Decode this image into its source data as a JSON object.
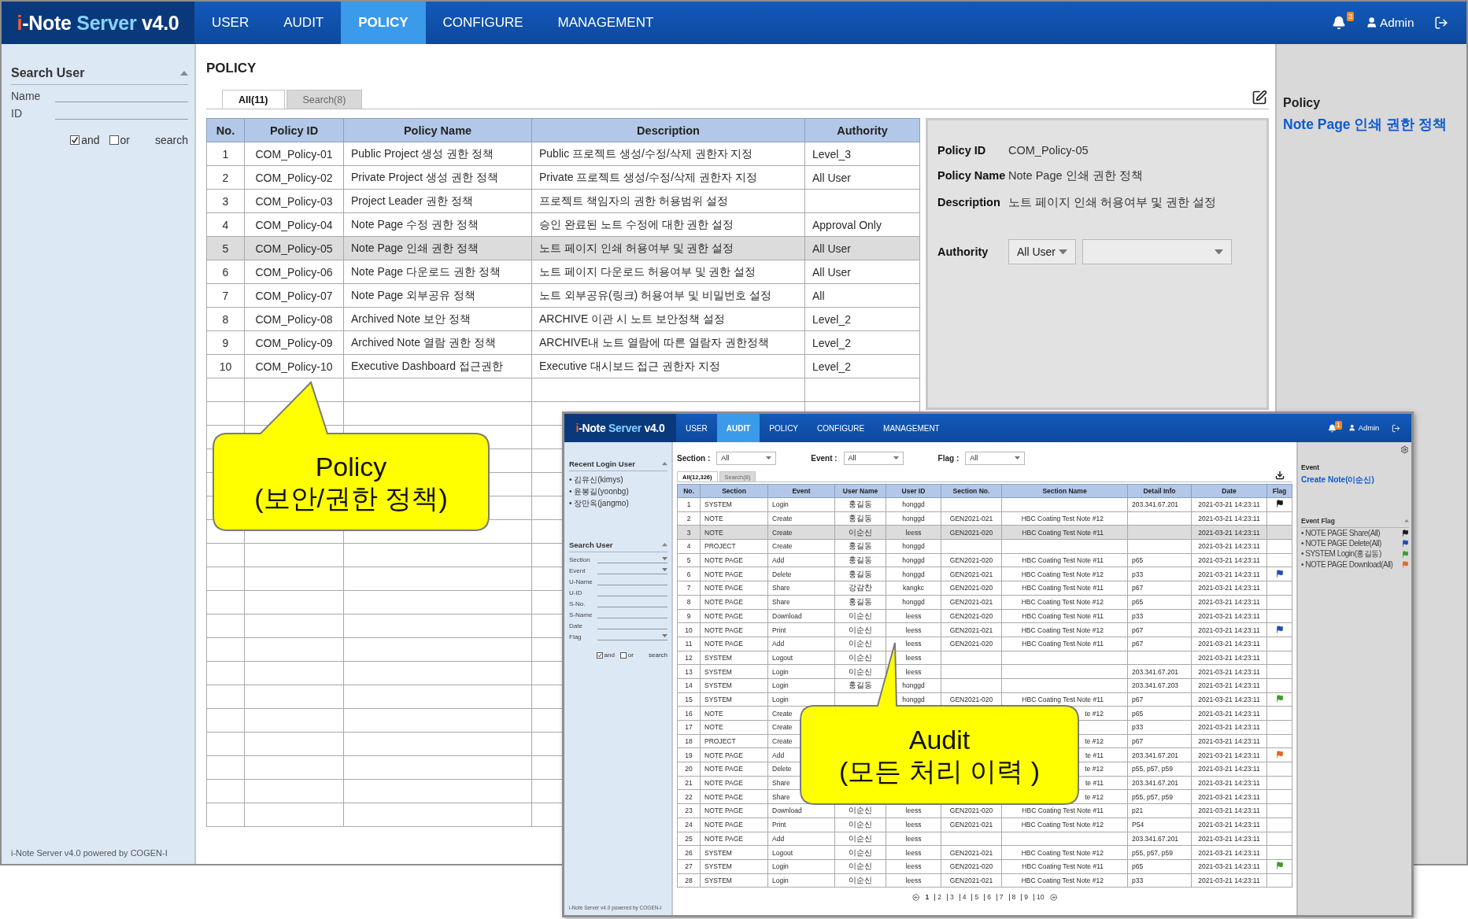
{
  "main": {
    "logo": {
      "mark": "i",
      "name": "-Note",
      "product": "Server",
      "version": "v4.0"
    },
    "nav": [
      {
        "label": "USER",
        "selected": false
      },
      {
        "label": "AUDIT",
        "selected": false
      },
      {
        "label": "POLICY",
        "selected": true
      },
      {
        "label": "CONFIGURE",
        "selected": false
      },
      {
        "label": "MANAGEMENT",
        "selected": false
      }
    ],
    "notifications": "3",
    "user": "Admin",
    "sidebar": {
      "title": "Search User",
      "fields": [
        {
          "label": "Name"
        },
        {
          "label": "ID"
        }
      ],
      "match_options": [
        {
          "label": "and",
          "checked": true
        },
        {
          "label": "or",
          "checked": false
        }
      ],
      "search": "search",
      "footer": "i-Note Server v4.0 powered by COGEN-I"
    },
    "page_title": "POLICY",
    "tabs": [
      {
        "label": "All(11)",
        "selected": true
      },
      {
        "label": "Search(8)",
        "selected": false
      }
    ],
    "table": {
      "columns": [
        "No.",
        "Policy ID",
        "Policy Name",
        "Description",
        "Authority"
      ],
      "rows": [
        {
          "no": "1",
          "policy_id": "COM_Policy-01",
          "policy_name": "Public Project 생성 권한 정책",
          "description": "Public 프로젝트 생성/수정/삭제 권한자 지정",
          "authority": "Level_3",
          "selected": false
        },
        {
          "no": "2",
          "policy_id": "COM_Policy-02",
          "policy_name": "Private Project 생성 권한 정책",
          "description": "Private 프로젝트 생성/수정/삭제 권한자 지정",
          "authority": "All User",
          "selected": false
        },
        {
          "no": "3",
          "policy_id": "COM_Policy-03",
          "policy_name": "Project Leader 권한 정책",
          "description": "프로젝트 책임자의 권한 허용범위 설정",
          "selected": false
        },
        {
          "no": "4",
          "policy_id": "COM_Policy-04",
          "policy_name": "Note Page 수정 권한 정책",
          "description": "승인 완료된 노트 수정에 대한 권한 설정",
          "authority": "Approval Only",
          "selected": false
        },
        {
          "no": "5",
          "policy_id": "COM_Policy-05",
          "policy_name": "Note Page 인쇄 권한 정책",
          "description": "노트 페이지 인쇄 허용여부 및 권한 설정",
          "authority": "All User",
          "selected": true
        },
        {
          "no": "6",
          "policy_id": "COM_Policy-06",
          "policy_name": "Note Page 다운로드 권한 정책",
          "description": "노트 페이지 다운로드 허용여부 및 권한 설정",
          "authority": "All User",
          "selected": false
        },
        {
          "no": "7",
          "policy_id": "COM_Policy-07",
          "policy_name": "Note Page 외부공유 정책",
          "description": "노트 외부공유(링크) 허용여부 및 비밀번호 설정",
          "authority": "All",
          "selected": false
        },
        {
          "no": "8",
          "policy_id": "COM_Policy-08",
          "policy_name": "Archived Note 보안 정책",
          "description": "ARCHIVE 이관 시 노트 보안정책 설정",
          "authority": "Level_2",
          "selected": false
        },
        {
          "no": "9",
          "policy_id": "COM_Policy-09",
          "policy_name": "Archived Note 열람 권한 정책",
          "description": "ARCHIVE내 노트 열람에 따른 열람자 권한정책",
          "authority": "Level_2",
          "selected": false
        },
        {
          "no": "10",
          "policy_id": "COM_Policy-10",
          "policy_name": "Executive Dashboard 접근권한",
          "description": "Executive 대시보드 접근 권한자 지정",
          "authority": "Level_2",
          "selected": false
        }
      ]
    },
    "detail": {
      "fields": [
        {
          "label": "Policy ID",
          "value": "COM_Policy-05"
        },
        {
          "label": "Policy Name",
          "value": "Note Page 인쇄 권한 정책"
        },
        {
          "label": "Description",
          "value": "노트 페이지 인쇄 허용여부 및 권한 설정"
        }
      ],
      "authority": {
        "label": "Authority",
        "value": "All User"
      }
    },
    "side_panel": {
      "label": "Policy",
      "value": "Note Page 인쇄 권한 정책"
    }
  },
  "audit_window": {
    "logo": {
      "mark": "i",
      "name": "-Note",
      "product": "Server",
      "version": "v4.0"
    },
    "nav": [
      {
        "label": "USER",
        "selected": false
      },
      {
        "label": "AUDIT",
        "selected": true
      },
      {
        "label": "POLICY",
        "selected": false
      },
      {
        "label": "CONFIGURE",
        "selected": false
      },
      {
        "label": "MANAGEMENT",
        "selected": false
      }
    ],
    "notifications": "1",
    "user": "Admin",
    "recent_login": {
      "title": "Recent Login User",
      "users": [
        "• 김유신(kimys)",
        "• 윤봉길(yoonbg)",
        "• 장만옥(jangmo)"
      ]
    },
    "search_user": {
      "title": "Search User",
      "fields": [
        {
          "label": "Section",
          "kind": "select"
        },
        {
          "label": "Event",
          "kind": "select"
        },
        {
          "label": "U-Name",
          "kind": "text"
        },
        {
          "label": "U-ID",
          "kind": "text"
        },
        {
          "label": "S-No.",
          "kind": "text"
        },
        {
          "label": "S-Name",
          "kind": "text"
        },
        {
          "label": "Date",
          "kind": "text"
        },
        {
          "label": "Flag",
          "kind": "select"
        }
      ],
      "match_options": [
        {
          "label": "and",
          "checked": true
        },
        {
          "label": "or",
          "checked": false
        }
      ],
      "search": "search"
    },
    "footer": "i-Note Server v4.0 powered by COGEN-I",
    "filters": [
      {
        "label": "Section :",
        "value": "All"
      },
      {
        "label": "Event :",
        "value": "All"
      },
      {
        "label": "Flag :",
        "value": "All"
      }
    ],
    "tabs": [
      {
        "label": "All(12,326)",
        "selected": true
      },
      {
        "label": "Search(8)",
        "selected": false
      }
    ],
    "table": {
      "columns": [
        "No.",
        "Section",
        "Event",
        "User Name",
        "User ID",
        "Section No.",
        "Section Name",
        "Detail Info",
        "Date",
        "Flag"
      ],
      "rows": [
        {
          "no": "1",
          "section": "SYSTEM",
          "event": "Login",
          "user_name": "홍길동",
          "user_id": "honggd",
          "detail_info": "203.341.67.201",
          "date": "2021-03-21 14:23:11",
          "color": "#1a1a1a",
          "selected": false
        },
        {
          "no": "2",
          "section": "NOTE",
          "event": "Create",
          "user_name": "홍길동",
          "user_id": "honggd",
          "section_no": "GEN2021-021",
          "section_name": "HBC Coating Test Note #12",
          "date": "2021-03-21 14:23:11",
          "selected": false
        },
        {
          "no": "3",
          "section": "NOTE",
          "event": "Create",
          "user_name": "이순신",
          "user_id": "leess",
          "section_no": "GEN2021-020",
          "section_name": "HBC Coating Test Note #11",
          "date": "2021-03-21 14:23:11",
          "selected": true
        },
        {
          "no": "4",
          "section": "PROJECT",
          "event": "Create",
          "user_name": "홍길동",
          "user_id": "honggd",
          "date": "2021-03-21 14:23:11",
          "selected": false
        },
        {
          "no": "5",
          "section": "NOTE PAGE",
          "event": "Add",
          "user_name": "홍길동",
          "user_id": "honggd",
          "section_no": "GEN2021-020",
          "section_name": "HBC Coating Test Note #11",
          "detail_info": "p65",
          "date": "2021-03-21 14:23:11",
          "selected": false
        },
        {
          "no": "6",
          "section": "NOTE PAGE",
          "event": "Delete",
          "user_name": "홍길동",
          "user_id": "honggd",
          "section_no": "GEN2021-021",
          "section_name": "HBC Coating Test Note #12",
          "detail_info": "p33",
          "date": "2021-03-21 14:23:11",
          "color": "#1f4fb5",
          "selected": false
        },
        {
          "no": "7",
          "section": "NOTE PAGE",
          "event": "Share",
          "user_name": "강감찬",
          "user_id": "kangkc",
          "section_no": "GEN2021-020",
          "section_name": "HBC Coating Test Note #11",
          "detail_info": "p67",
          "date": "2021-03-21 14:23:11",
          "selected": false
        },
        {
          "no": "8",
          "section": "NOTE PAGE",
          "event": "Share",
          "user_name": "홍길동",
          "user_id": "honggd",
          "section_no": "GEN2021-021",
          "section_name": "HBC Coating Test Note #12",
          "detail_info": "p65",
          "date": "2021-03-21 14:23:11",
          "selected": false
        },
        {
          "no": "9",
          "section": "NOTE PAGE",
          "event": "Download",
          "user_name": "이순신",
          "user_id": "leess",
          "section_no": "GEN2021-020",
          "section_name": "HBC Coating Test Note #11",
          "detail_info": "p33",
          "date": "2021-03-21 14:23:11",
          "selected": false
        },
        {
          "no": "10",
          "section": "NOTE PAGE",
          "event": "Print",
          "user_name": "이순신",
          "user_id": "leess",
          "section_no": "GEN2021-021",
          "section_name": "HBC Coating Test Note #12",
          "detail_info": "p67",
          "date": "2021-03-21 14:23:11",
          "color": "#1f4fb5",
          "selected": false
        },
        {
          "no": "11",
          "section": "NOTE PAGE",
          "event": "Add",
          "user_name": "이순신",
          "user_id": "leess",
          "section_no": "GEN2021-020",
          "section_name": "HBC Coating Test Note #11",
          "detail_info": "p67",
          "date": "2021-03-21 14:23:11",
          "selected": false
        },
        {
          "no": "12",
          "section": "SYSTEM",
          "event": "Logout",
          "user_name": "이순신",
          "user_id": "leess",
          "date": "2021-03-21 14:23:11",
          "selected": false
        },
        {
          "no": "13",
          "section": "SYSTEM",
          "event": "Login",
          "user_name": "이순신",
          "user_id": "leess",
          "detail_info": "203.341.67.201",
          "date": "2021-03-21 14:23:11",
          "selected": false
        },
        {
          "no": "14",
          "section": "SYSTEM",
          "event": "Login",
          "user_name": "홍길동",
          "user_id": "honggd",
          "detail_info": "203.341.67.203",
          "date": "2021-03-21 14:23:11",
          "selected": false
        },
        {
          "no": "15",
          "section": "SYSTEM",
          "event": "Login",
          "user_id": "honggd",
          "section_no": "GEN2021-020",
          "section_name": "HBC Coating Test Note #11",
          "detail_info": "p67",
          "date": "2021-03-21 14:23:11",
          "color": "#3f9a2c",
          "selected": false
        },
        {
          "no": "16",
          "section": "NOTE",
          "event": "Create",
          "section_name": "te #12",
          "detail_info": "p65",
          "date": "2021-03-21 14:23:11",
          "selected": false
        },
        {
          "no": "17",
          "section": "NOTE",
          "event": "Create",
          "detail_info": "p33",
          "date": "2021-03-21 14:23:11",
          "selected": false
        },
        {
          "no": "18",
          "section": "PROJECT",
          "event": "Create",
          "section_name": "te #12",
          "detail_info": "p67",
          "date": "2021-03-21 14:23:11",
          "selected": false
        },
        {
          "no": "19",
          "section": "NOTE PAGE",
          "event": "Add",
          "section_name": "te #11",
          "detail_info": "203.341.67.201",
          "date": "2021-03-21 14:23:11",
          "color": "#e06a1b",
          "selected": false
        },
        {
          "no": "20",
          "section": "NOTE PAGE",
          "event": "Delete",
          "section_name": "te #12",
          "detail_info": "p55, p57, p59",
          "date": "2021-03-21 14:23:11",
          "selected": false
        },
        {
          "no": "21",
          "section": "NOTE PAGE",
          "event": "Share",
          "section_name": "te #11",
          "detail_info": "203.341.67.201",
          "date": "2021-03-21 14:23:11",
          "selected": false
        },
        {
          "no": "22",
          "section": "NOTE PAGE",
          "event": "Share",
          "section_name": "te #12",
          "detail_info": "p55, p57, p59",
          "date": "2021-03-21 14:23:11",
          "selected": false
        },
        {
          "no": "23",
          "section": "NOTE PAGE",
          "event": "Download",
          "user_name": "이순신",
          "user_id": "leess",
          "section_no": "GEN2021-020",
          "section_name": "HBC Coating Test Note #11",
          "detail_info": "p21",
          "date": "2021-03-21 14:23:11",
          "selected": false
        },
        {
          "no": "24",
          "section": "NOTE PAGE",
          "event": "Print",
          "user_name": "이순신",
          "user_id": "leess",
          "section_no": "GEN2021-021",
          "section_name": "HBC Coating Test Note #12",
          "detail_info": "P54",
          "date": "2021-03-21 14:23:11",
          "selected": false
        },
        {
          "no": "25",
          "section": "NOTE PAGE",
          "event": "Add",
          "user_name": "이순신",
          "user_id": "leess",
          "detail_info": "203.341.67.201",
          "date": "2021-03-21 14:23:11",
          "selected": false
        },
        {
          "no": "26",
          "section": "SYSTEM",
          "event": "Logout",
          "user_name": "이순신",
          "user_id": "leess",
          "section_no": "GEN2021-021",
          "section_name": "HBC Coating Test Note #12",
          "detail_info": "p55, p57, p59",
          "date": "2021-03-21 14:23:11",
          "selected": false
        },
        {
          "no": "27",
          "section": "SYSTEM",
          "event": "Login",
          "user_name": "이순신",
          "user_id": "leess",
          "section_no": "GEN2021-020",
          "section_name": "HBC Coating Test Note #11",
          "detail_info": "p65",
          "date": "2021-03-21 14:23:11",
          "color": "#3f9a2c",
          "selected": false
        },
        {
          "no": "28",
          "section": "SYSTEM",
          "event": "Login",
          "user_name": "이순신",
          "user_id": "leess",
          "section_no": "GEN2021-021",
          "section_name": "HBC Coating Test Note #12",
          "detail_info": "p33",
          "date": "2021-03-21 14:23:11",
          "selected": false
        }
      ]
    },
    "pages": [
      {
        "label": "1",
        "selected": true
      },
      {
        "label": "2",
        "selected": false
      },
      {
        "label": "3",
        "selected": false
      },
      {
        "label": "4",
        "selected": false
      },
      {
        "label": "5",
        "selected": false
      },
      {
        "label": "6",
        "selected": false
      },
      {
        "label": "7",
        "selected": false
      },
      {
        "label": "8",
        "selected": false
      },
      {
        "label": "9",
        "selected": false
      },
      {
        "label": "10",
        "selected": false
      }
    ],
    "event_panel": {
      "label": "Event",
      "value": "Create Note(이순신)"
    },
    "event_flags": {
      "title": "Event Flag",
      "items": [
        {
          "label": "• NOTE PAGE Share(All)",
          "color": "#1a1a1a"
        },
        {
          "label": "• NOTE PAGE Delete(All)",
          "color": "#1f4fb5"
        },
        {
          "label": "• SYSTEM Login(홍길동)",
          "color": "#3f9a2c"
        },
        {
          "label": "• NOTE PAGE Download(All)",
          "color": "#e06a1b"
        }
      ]
    }
  },
  "callouts": [
    {
      "lines": [
        "Policy",
        "(보안/권한 정책)"
      ]
    },
    {
      "lines": [
        "Audit",
        "(모든 처리 이력 )"
      ]
    }
  ]
}
